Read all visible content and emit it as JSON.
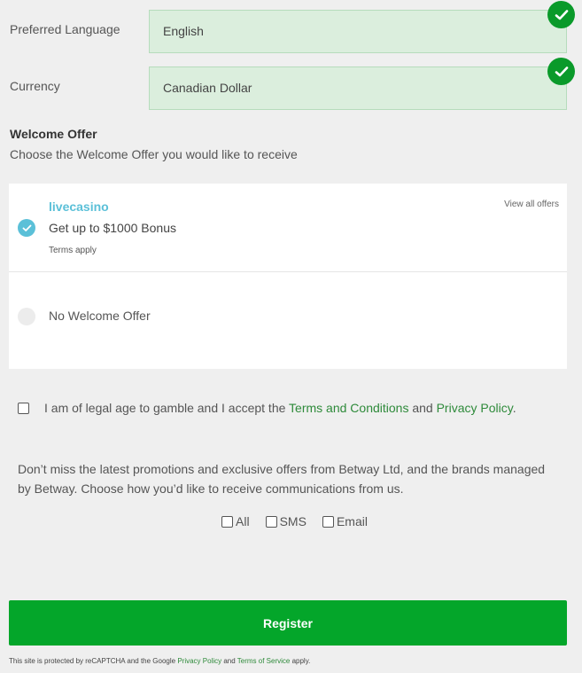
{
  "fields": [
    {
      "label": "Preferred Language",
      "value": "English",
      "valid": true
    },
    {
      "label": "Currency",
      "value": "Canadian Dollar",
      "valid": true
    }
  ],
  "welcome_offer": {
    "title": "Welcome Offer",
    "subtitle": "Choose the Welcome Offer you would like to receive",
    "view_all": "View all offers",
    "offers": [
      {
        "brand": "livecasino",
        "title": "Get up to $1000 Bonus",
        "terms": "Terms apply",
        "selected": true
      },
      {
        "title": "No Welcome Offer",
        "selected": false
      }
    ]
  },
  "accept": {
    "prefix": "I am of legal age to gamble and I accept the ",
    "terms_link": "Terms and Conditions",
    "middle": " and ",
    "privacy_link": "Privacy Policy",
    "suffix": ".",
    "checked": false
  },
  "promotions": {
    "text": "Don’t miss the latest promotions and exclusive offers from Betway Ltd, and the brands managed by Betway. Choose how you’d like to receive communications from us.",
    "options": [
      "All",
      "SMS",
      "Email"
    ]
  },
  "register_label": "Register",
  "recaptcha": {
    "prefix": "This site is protected by reCAPTCHA and the Google ",
    "privacy_link": "Privacy Policy",
    "middle": " and ",
    "terms_link": "Terms of Service",
    "suffix": " apply."
  },
  "colors": {
    "accent_green": "#04a62a",
    "valid_green": "#0a9a2a",
    "offer_blue": "#5bc0d8",
    "link_green": "#2e8a3a"
  }
}
